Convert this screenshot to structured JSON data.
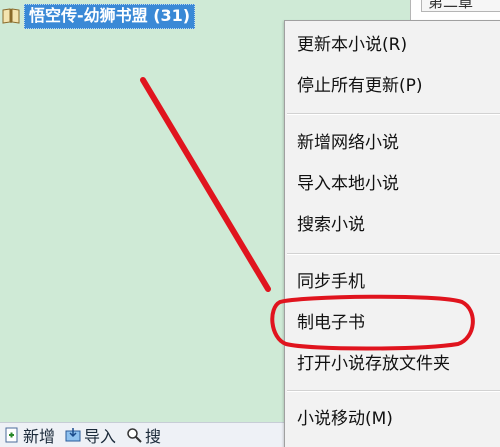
{
  "tree": {
    "node_label": "悟空传-幼狮书盟 (31)"
  },
  "right_pane": {
    "tab_label": "第二章"
  },
  "context_menu": {
    "items": [
      {
        "label": "更新本小说(R)"
      },
      {
        "label": "停止所有更新(P)"
      },
      {
        "label": "新增网络小说"
      },
      {
        "label": "导入本地小说"
      },
      {
        "label": "搜索小说"
      },
      {
        "label": "同步手机"
      },
      {
        "label": "制电子书"
      },
      {
        "label": "打开小说存放文件夹"
      },
      {
        "label": "小说移动(M)"
      }
    ]
  },
  "toolbar": {
    "new_label": "新增",
    "import_label": "导入",
    "search_label": "搜"
  },
  "colors": {
    "tree_background": "#cfead6",
    "selection": "#3a89d6",
    "menu_background": "#f2f2f2",
    "annotation_red": "#e0141e"
  }
}
